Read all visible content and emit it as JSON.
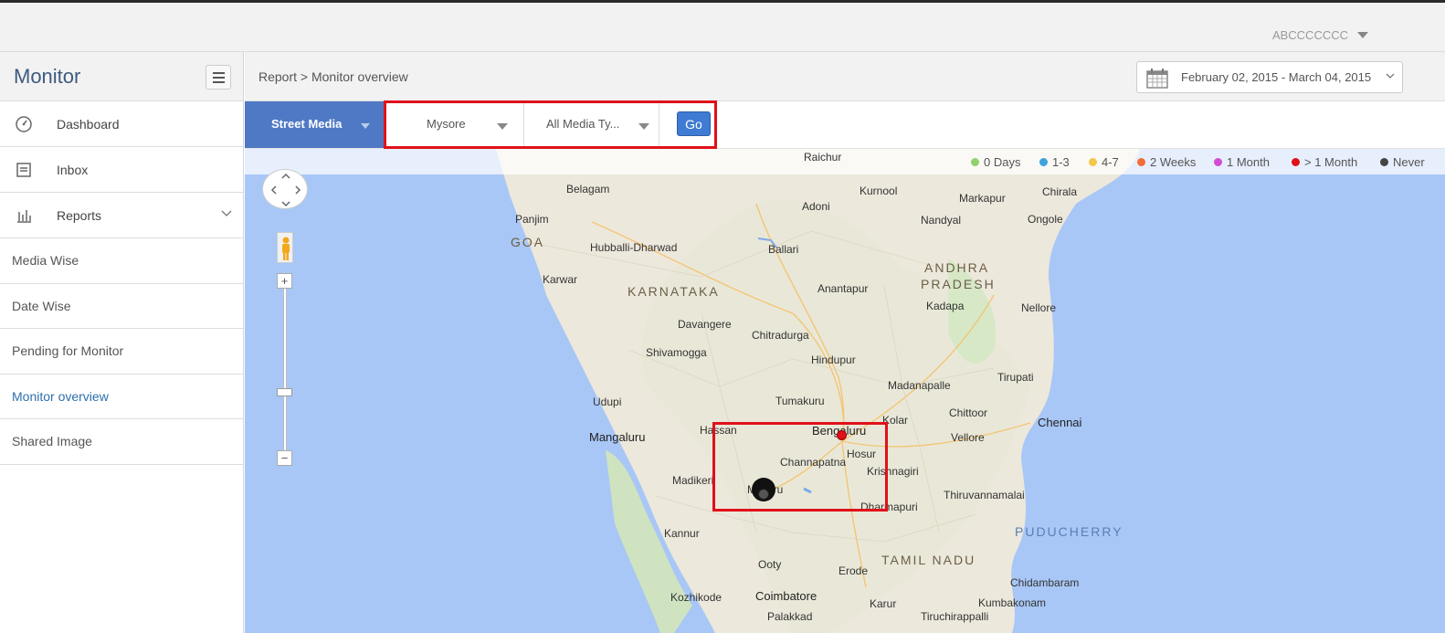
{
  "header": {
    "user_name": "ABCCCCCCC"
  },
  "sidebar": {
    "title": "Monitor",
    "nav": [
      {
        "label": "Dashboard",
        "icon": "dashboard-icon"
      },
      {
        "label": "Inbox",
        "icon": "inbox-icon"
      },
      {
        "label": "Reports",
        "icon": "reports-icon"
      }
    ],
    "report_items": [
      {
        "label": "Media Wise"
      },
      {
        "label": "Date Wise"
      },
      {
        "label": "Pending for Monitor"
      },
      {
        "label": "Monitor overview",
        "active": true
      },
      {
        "label": "Shared Image"
      }
    ]
  },
  "breadcrumb": "Report > Monitor overview",
  "date_range": "February 02, 2015 - March 04, 2015",
  "filters": {
    "media_category": "Street Media",
    "city": "Mysore",
    "media_type": "All Media Ty...",
    "go_label": "Go"
  },
  "legend": [
    {
      "label": "0 Days",
      "color": "#8fd16b"
    },
    {
      "label": "1-3",
      "color": "#3fa3dd"
    },
    {
      "label": "4-7",
      "color": "#f2c84b"
    },
    {
      "label": "2 Weeks",
      "color": "#f06d3a"
    },
    {
      "label": "1 Month",
      "color": "#d14dd3"
    },
    {
      "label": "> 1 Month",
      "color": "#e0111a"
    },
    {
      "label": "Never",
      "color": "#444444"
    }
  ],
  "map": {
    "zoom_in": "+",
    "zoom_out": "−",
    "labels": {
      "karnataka": "KARNATAKA",
      "andhra": "ANDHRA",
      "pradesh": "PRADESH",
      "tamil_nadu": "TAMIL NADU",
      "puducherry": "PUDUCHERRY",
      "goa": "GOA",
      "bengaluru": "Bengaluru",
      "chennai": "Chennai",
      "mysuru": "Mysuru",
      "hosur": "Hosur",
      "hassan": "Hassan",
      "channapatna": "Channapatna",
      "krishnagiri": "Krishnagiri",
      "dharmapuri": "Dharmapuri",
      "coimbatore": "Coimbatore",
      "mangaluru": "Mangaluru",
      "tumakuru": "Tumakuru",
      "kurnool": "Kurnool",
      "nellore": "Nellore",
      "tirupati": "Tirupati",
      "vellore": "Vellore",
      "hubballi": "Hubballi-Dharwad",
      "belagam": "Belagam",
      "ballari": "Ballari",
      "anantapur": "Anantapur",
      "kadapa": "Kadapa",
      "ongole": "Ongole",
      "chitradurga": "Chitradurga",
      "davangere": "Davangere",
      "shivamogga": "Shivamogga",
      "udupi": "Udupi",
      "erode": "Erode",
      "ooty": "Ooty",
      "kozhikode": "Kozhikode",
      "hindupur": "Hindupur",
      "kolar": "Kolar",
      "chittoor": "Chittoor",
      "adoni": "Adoni",
      "raichur": "Raichur",
      "madikeri": "Madikeri",
      "kannur": "Kannur",
      "salem_area": "Thiruvannamalai",
      "chidambaram": "Chidambaram",
      "kumbakonam": "Kumbakonam",
      "tiruchirappalli": "Tiruchirappalli",
      "karur": "Karur",
      "palakkad": "Palakkad",
      "panjim": "Panjim",
      "karwar": "Karwar",
      "madanapalle": "Madanapalle",
      "nandyal": "Nandyal",
      "markapur": "Markapur",
      "chirala": "Chirala"
    }
  }
}
